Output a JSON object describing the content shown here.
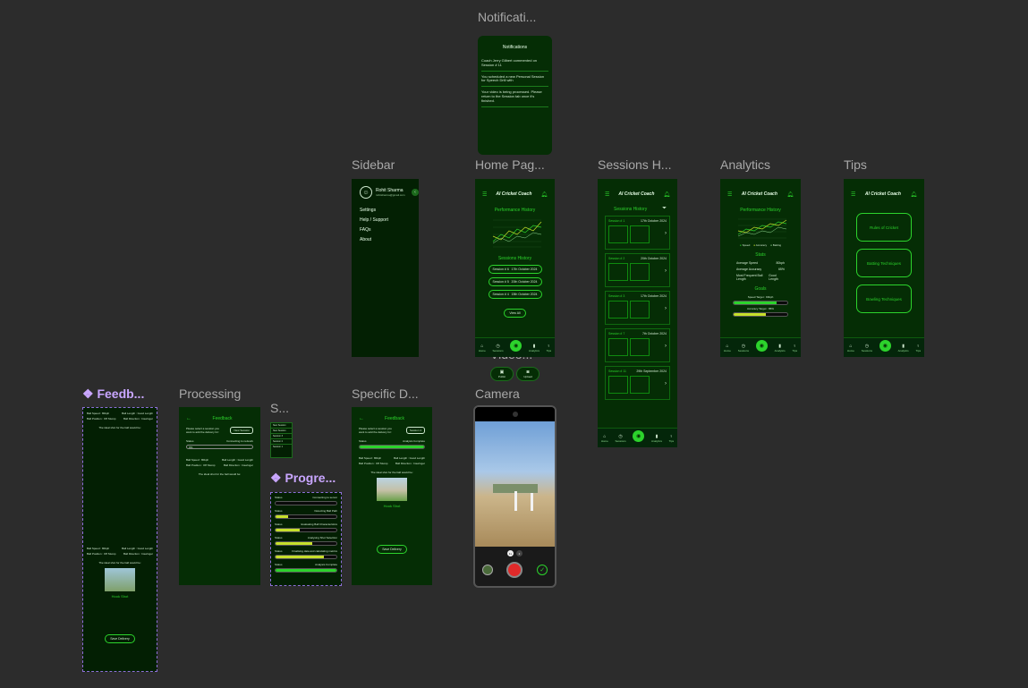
{
  "labels": {
    "notifications": "Notificati...",
    "sidebar": "Sidebar",
    "home": "Home Pag...",
    "sessions": "Sessions H...",
    "analytics": "Analytics",
    "tips": "Tips",
    "video": "Video...",
    "feedback": "❖ Feedb...",
    "processing": "Processing",
    "s_small": "S...",
    "specific": "Specific D...",
    "camera": "Camera",
    "progress": "❖ Progre..."
  },
  "notifications": {
    "title": "Notifications",
    "items": [
      "Coach Jerry Gilbert commented on Session # 11",
      "You scheduled a new Personal Session for Speech Drill with",
      "Your video is being processed. Please return to the Session tab once it's finished."
    ]
  },
  "sidebar": {
    "user_name": "Rohit Sharma",
    "user_email": "rohitsharma@gmail.com",
    "items": [
      "Settings",
      "Help / Support",
      "FAQs",
      "About"
    ]
  },
  "app": {
    "title": "AI Cricket Coach",
    "performance_history": "Performance History",
    "sessions_history": "Sessions History",
    "stats": "Stats",
    "goals": "Goals",
    "view_all": "View All",
    "nav": [
      "Home",
      "Sessions",
      "",
      "Analytics",
      "Tips"
    ]
  },
  "home": {
    "sessions": [
      {
        "name": "Session # 6",
        "date": "17th October 2024"
      },
      {
        "name": "Session # 5",
        "date": "20th October 2024"
      },
      {
        "name": "Session # 4",
        "date": "15th October 2024"
      }
    ]
  },
  "sessions_list": [
    {
      "name": "Session # 1",
      "date": "17th October 2024"
    },
    {
      "name": "Session # 2",
      "date": "20th October 2024"
    },
    {
      "name": "Session # 3",
      "date": "17th October 2024"
    },
    {
      "name": "Session # 7",
      "date": "7th October 2024"
    },
    {
      "name": "Session # 11",
      "date": "29th September 2024"
    }
  ],
  "analytics": {
    "legend": [
      "Speed",
      "Accuracy",
      "Batting"
    ],
    "stats": [
      {
        "k": "Average Speed",
        "v": "80kph"
      },
      {
        "k": "Average Accuracy",
        "v": "65%"
      },
      {
        "k": "Most Frequent Ball Length",
        "v": "Good Length"
      }
    ],
    "goals": [
      {
        "label": "Speed Target : 90kph",
        "value": 80
      },
      {
        "label": "Accuracy Target : 85%",
        "value": 60
      }
    ]
  },
  "tips": [
    "Rules of Cricket",
    "Batting Techniques",
    "Bowling Techniques"
  ],
  "video_buttons": [
    "Public",
    "Upload"
  ],
  "feedback": {
    "title": "Feedback",
    "prompt": "Please select a session you want to add the delivery for:",
    "select": "New Session",
    "status_label": "Status",
    "status_value": "Connecting to network",
    "percent": "0%",
    "ideal_text": "The ideal shot for the ball would be:",
    "shot_name": "Hook Shot",
    "back_button": "Save Delivery",
    "metrics": [
      "Ball Speed : 80kph",
      "Ball Length : Good Length",
      "Ball Position : Off Stump",
      "Ball Direction : Inswinger"
    ]
  },
  "processing_list": [
    "New Session",
    "New Session",
    "Session 3",
    "Session 2",
    "Session 1"
  ],
  "progress_states": [
    {
      "label": "Status",
      "value": "Connecting to server",
      "pct": 0
    },
    {
      "label": "Status",
      "value": "Detecting Ball Path",
      "pct": 20
    },
    {
      "label": "Status",
      "value": "Evaluating Ball Characteristics",
      "pct": 40
    },
    {
      "label": "Status",
      "value": "Analysing Shot Selection",
      "pct": 60
    },
    {
      "label": "Status",
      "value": "Finalising data and calculating metrics",
      "pct": 80
    },
    {
      "label": "Status",
      "value": "Analysis Complete",
      "pct": 100
    }
  ],
  "specific": {
    "select": "Session 4",
    "status_value": "Analysis Complete"
  },
  "camera": {
    "mode_a": "1x",
    "mode_b": "2"
  },
  "colors": {
    "bg": "#2c2c2c",
    "frame": "#052d05",
    "accent": "#2cd32c",
    "accent_yellow": "#c6e02a",
    "component_purple": "#c9a6ff"
  }
}
